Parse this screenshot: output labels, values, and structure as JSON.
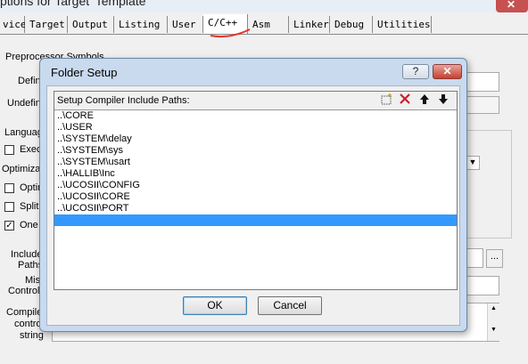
{
  "window": {
    "title_fragment": "ptions for Target 'Template'"
  },
  "tabs": [
    {
      "label": "vice"
    },
    {
      "label": "Target"
    },
    {
      "label": "Output"
    },
    {
      "label": "Listing"
    },
    {
      "label": "User"
    },
    {
      "label": "C/C++"
    },
    {
      "label": "Asm"
    },
    {
      "label": "Linker"
    },
    {
      "label": "Debug"
    },
    {
      "label": "Utilities"
    }
  ],
  "background": {
    "preprocessor_label": "Preprocessor Symbols",
    "define_label": "Defin",
    "undefine_label": "Undefin",
    "language_label": "Languag",
    "execute_label": "Exec",
    "optimization_label": "Optimiza",
    "optim_label": "Optin",
    "split_label": "Split",
    "one_label": "One",
    "one_checked": "✓",
    "include_label": "Include",
    "paths_label": "Paths",
    "misc_label": "Misc",
    "controls_label": "Controls",
    "compiler_label": "Compiler",
    "control_label": "contro",
    "string_label": "string",
    "browse_label": "..."
  },
  "dialog": {
    "title": "Folder Setup",
    "help_label": "?",
    "close_label": "✕",
    "list_header": "Setup Compiler Include Paths:",
    "paths": [
      "..\\CORE",
      "..\\USER",
      "..\\SYSTEM\\delay",
      "..\\SYSTEM\\sys",
      "..\\SYSTEM\\usart",
      "..\\HALLIB\\Inc",
      "..\\UCOSII\\CONFIG",
      "..\\UCOSII\\CORE",
      "..\\UCOSII\\PORT",
      ""
    ],
    "selected_index": 9,
    "ok_label": "OK",
    "cancel_label": "Cancel"
  },
  "colors": {
    "selection": "#3399ff",
    "annotation": "#e8322f"
  }
}
